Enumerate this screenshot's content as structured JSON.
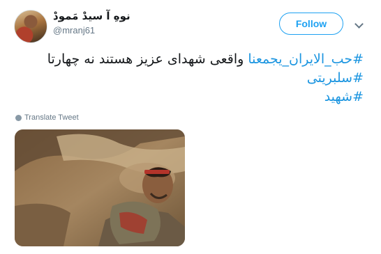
{
  "author": {
    "display_name": "نوهِ آ سیدْ مَمودْ",
    "handle": "@mranj61"
  },
  "follow_label": "Follow",
  "tweet": {
    "line1_hashtag": "#حب_الایران_یجمعنا",
    "line1_text": " واقعی شهدای عزیز هستند نه چهارتا",
    "line2_hashtag": "#سلبریتی",
    "line3_hashtag": "#شهید"
  },
  "translate_label": "Translate Tweet",
  "colors": {
    "accent": "#1da1f2",
    "hashtag": "#1b95e0",
    "text": "#14171a",
    "muted": "#657786"
  },
  "icons": {
    "more": "chevron-down-icon",
    "translate": "globe-icon"
  }
}
